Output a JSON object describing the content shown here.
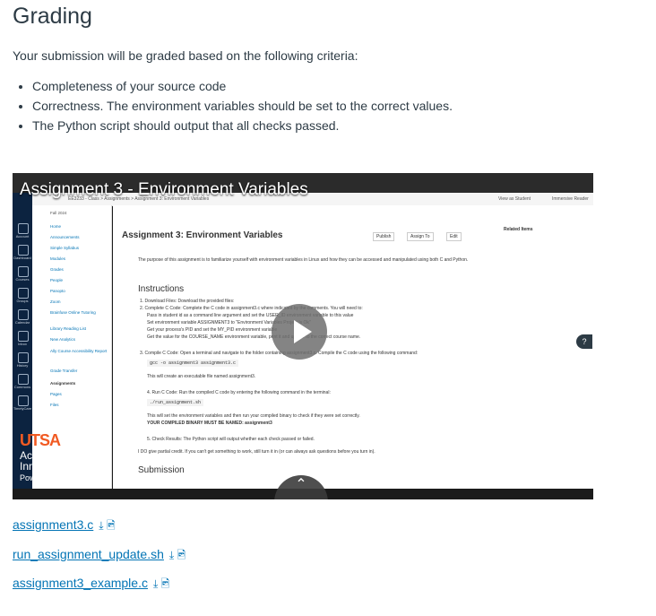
{
  "page": {
    "title": "Grading",
    "intro": "Your submission will be graded based on the following criteria:",
    "criteria": [
      "Completeness of your source code",
      "Correctness. The environment variables should be set to the correct values.",
      "The Python script should output that all checks passed."
    ]
  },
  "video": {
    "title": "Assignment 3 - Environment Variables",
    "logo_line1": "UTSA",
    "logo_line2": "Academic",
    "logo_line3": "Innovation",
    "powered_by": "Powered by Panopto",
    "screen": {
      "breadcrumb": "EE3233 - Class  >  Assignments  >  Assignment 3: Environment Variables",
      "view_as_student": "View as Student",
      "immersive_reader": "Immersive Reader",
      "related_items": "Related Items",
      "assignment_title": "Assignment 3: Environment Variables",
      "publish": "Publish",
      "assign_to": "Assign To",
      "edit": "Edit",
      "purpose": "The purpose of this assignment is to familiarize yourself with environment variables in Linux and how they can be accessed and manipulated using both C and Python.",
      "instructions_heading": "Instructions",
      "step1": "1. Download Files: Download the provided files:",
      "step2": "2. Complete C Code: Complete the C code in assignment3.c where indicated by the comments. You will need to:",
      "step2a": "Pass in student id as a command line argument and set the USER_ID environment variable to this value",
      "step2b": "Set environment variable ASSIGNMENT3 to \"Environment Variables Project Is Ok\"",
      "step2c": "Get your process's PID and set the MY_PID environment variable",
      "step2d": "Get the value for the COURSE_NAME environment variable, print it and update to the correct course name.",
      "step3": "3. Compile C Code: Open a terminal and navigate to the folder containing assignment3.c. Compile the C code using the following command:",
      "step3_cmd": "gcc -o assignment3 assignment3.c",
      "step3_note": "This will create an executable file named assignment3.",
      "step4": "4. Run C Code: Run the compiled C code by entering the following command in the terminal:",
      "step4_cmd": "./run_assignment.sh",
      "step4_note": "This will set the environment variables and then run your compiled binary to check if they were set correctly.",
      "step4_bold": "YOUR COMPILED BINARY MUST BE NAMED: assignment3",
      "step5": "5. Check Results: The Python script will output whether each check passed or failed.",
      "step5_note": "I DO give partial credit. If you can't get something to work, still turn it in (or can always ask questions before you turn in).",
      "submission": "Submission",
      "global_nav": [
        "Account",
        "Dashboard",
        "Courses",
        "Groups",
        "Calendar",
        "Inbox",
        "History",
        "Commons",
        "TimelyCare"
      ],
      "course_nav": [
        "Fall 2024",
        "Home",
        "Announcements",
        "Simple Syllabus",
        "Modules",
        "Grades",
        "People",
        "Panopto",
        "Zoom",
        "Brainfuse Online Tutoring",
        "Library Reading List",
        "New Analytics",
        "Ally Course Accessibility Report",
        "Grade Transfer",
        "Assignments",
        "Pages",
        "Files"
      ]
    }
  },
  "files": [
    {
      "name": "assignment3.c"
    },
    {
      "name": "run_assignment_update.sh"
    },
    {
      "name": "assignment3_example.c"
    }
  ],
  "icons": {
    "download": "download-icon",
    "immersive": "immersive-reader-icon",
    "play": "play-icon",
    "expand": "expand-arrow-icon",
    "cc": "closed-captions-icon",
    "settings": "gear-icon",
    "fullscreen": "fullscreen-icon",
    "chevron": "chevron-up-icon",
    "help": "help-icon"
  },
  "colors": {
    "link": "#0374b5",
    "text": "#2d3b45",
    "utsa_orange": "#f15a22",
    "utsa_navy": "#0c2340"
  }
}
